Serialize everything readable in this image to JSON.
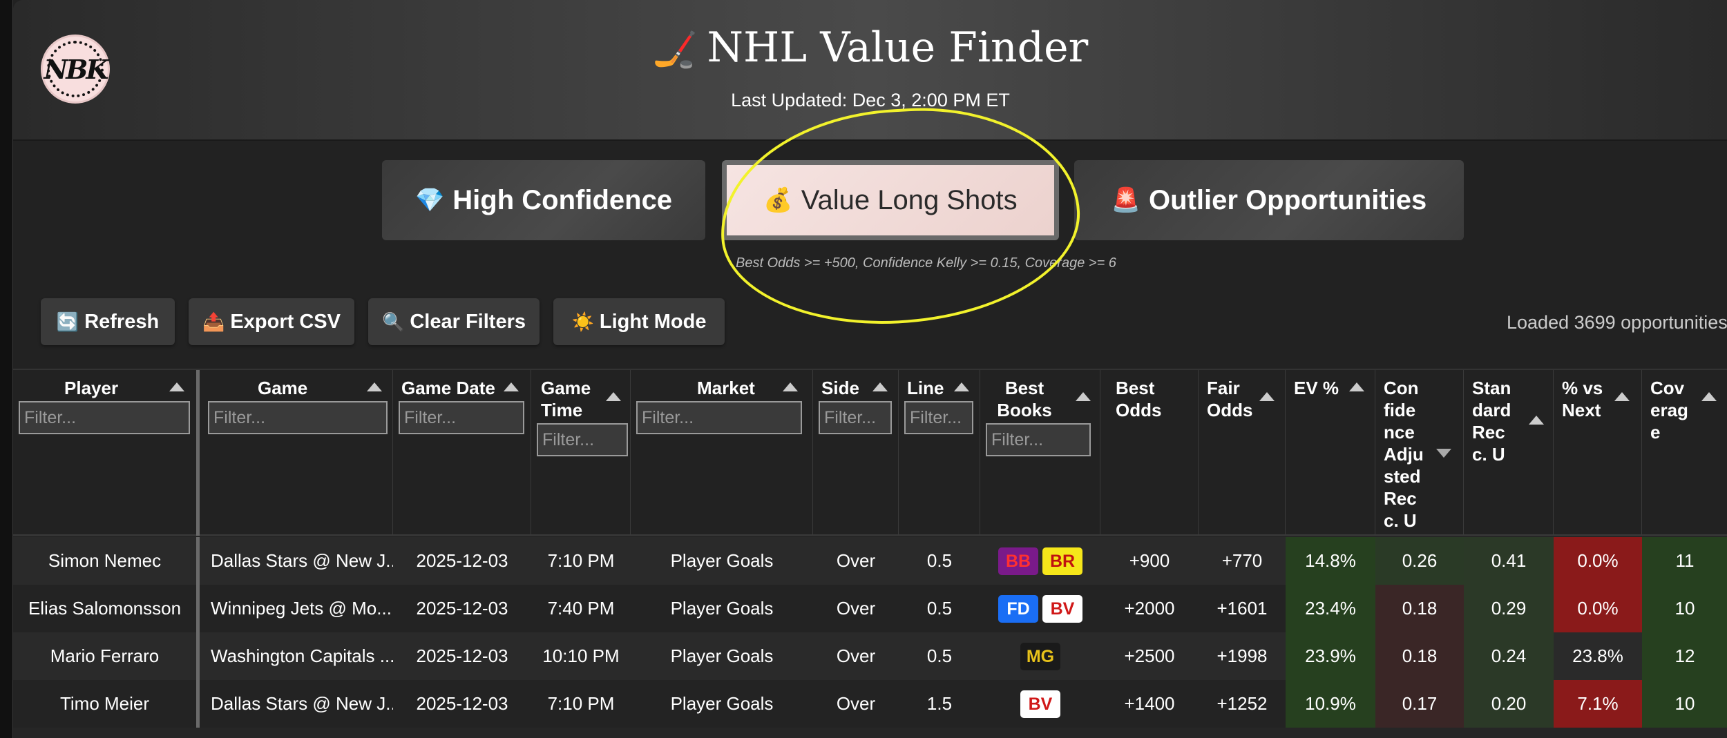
{
  "header": {
    "title": "NHL Value Finder",
    "title_icon": "hockey-stick-icon",
    "last_updated": "Last Updated: Dec 3, 2:00 PM ET",
    "logo_text": "NBK"
  },
  "tabs": [
    {
      "icon": "💎",
      "label": "High Confidence",
      "active": false
    },
    {
      "icon": "💰",
      "label": "Value Long Shots",
      "active": true
    },
    {
      "icon": "🚨",
      "label": "Outlier Opportunities",
      "active": false
    }
  ],
  "tab_hint": "Best Odds >= +500, Confidence Kelly >= 0.15, Coverage >= 6",
  "toolbar": {
    "refresh": {
      "icon": "🔄",
      "label": "Refresh"
    },
    "export": {
      "icon": "📤",
      "label": "Export CSV"
    },
    "clear": {
      "icon": "🔍",
      "label": "Clear Filters"
    },
    "light": {
      "icon": "☀️",
      "label": "Light Mode"
    }
  },
  "status": "Loaded 3699 opportunities",
  "filter_placeholder": "Filter...",
  "columns": [
    {
      "key": "player",
      "label": "Player"
    },
    {
      "key": "game",
      "label": "Game"
    },
    {
      "key": "date",
      "label": "Game Date"
    },
    {
      "key": "time",
      "label": "Game Time"
    },
    {
      "key": "market",
      "label": "Market"
    },
    {
      "key": "side",
      "label": "Side"
    },
    {
      "key": "line",
      "label": "Line"
    },
    {
      "key": "books",
      "label": "Best Books"
    },
    {
      "key": "best_odds",
      "label": "Best Odds"
    },
    {
      "key": "fair_odds",
      "label": "Fair Odds"
    },
    {
      "key": "ev",
      "label": "EV %"
    },
    {
      "key": "conf",
      "label": "Confidence Adjusted Recc. U"
    },
    {
      "key": "std",
      "label": "Standard Recc. U"
    },
    {
      "key": "vsnext",
      "label": "% vs Next"
    },
    {
      "key": "coverage",
      "label": "Coverage"
    }
  ],
  "rows": [
    {
      "player": "Simon Nemec",
      "game": "Dallas Stars @ New J...",
      "date": "2025-12-03",
      "time": "7:10 PM",
      "market": "Player Goals",
      "side": "Over",
      "line": "0.5",
      "books": [
        {
          "code": "BB",
          "bg": "#7a1a8a",
          "fg": "#ff3030"
        },
        {
          "code": "BR",
          "bg": "#f5e61a",
          "fg": "#c01010"
        }
      ],
      "best_odds": "+900",
      "fair_odds": "+770",
      "ev": "14.8%",
      "conf": "0.26",
      "std": "0.41",
      "vsnext": "0.0%",
      "coverage": "11"
    },
    {
      "player": "Elias Salomonsson",
      "game": "Winnipeg Jets @ Mo...",
      "date": "2025-12-03",
      "time": "7:40 PM",
      "market": "Player Goals",
      "side": "Over",
      "line": "0.5",
      "books": [
        {
          "code": "FD",
          "bg": "#1a6ef5",
          "fg": "#ffffff"
        },
        {
          "code": "BV",
          "bg": "#ffffff",
          "fg": "#d01818"
        }
      ],
      "best_odds": "+2000",
      "fair_odds": "+1601",
      "ev": "23.4%",
      "conf": "0.18",
      "std": "0.29",
      "vsnext": "0.0%",
      "coverage": "10"
    },
    {
      "player": "Mario Ferraro",
      "game": "Washington Capitals ...",
      "date": "2025-12-03",
      "time": "10:10 PM",
      "market": "Player Goals",
      "side": "Over",
      "line": "0.5",
      "books": [
        {
          "code": "MG",
          "bg": "#1a1a1a",
          "fg": "#e8c21a"
        }
      ],
      "best_odds": "+2500",
      "fair_odds": "+1998",
      "ev": "23.9%",
      "conf": "0.18",
      "std": "0.24",
      "vsnext": "23.8%",
      "coverage": "12"
    },
    {
      "player": "Timo Meier",
      "game": "Dallas Stars @ New J...",
      "date": "2025-12-03",
      "time": "7:10 PM",
      "market": "Player Goals",
      "side": "Over",
      "line": "1.5",
      "books": [
        {
          "code": "BV",
          "bg": "#ffffff",
          "fg": "#d01818"
        }
      ],
      "best_odds": "+1400",
      "fair_odds": "+1252",
      "ev": "10.9%",
      "conf": "0.17",
      "std": "0.20",
      "vsnext": "7.1%",
      "coverage": "10"
    }
  ],
  "cell_tones": {
    "ev": [
      "g",
      "g",
      "g",
      "g"
    ],
    "conf": [
      "gd",
      "dk",
      "dk",
      "dk"
    ],
    "std": [
      "gdim",
      "gdim",
      "gdim",
      "gdim"
    ],
    "vsnext": [
      "r",
      "r",
      "",
      "r"
    ],
    "coverage": [
      "g",
      "g",
      "g",
      "g"
    ]
  }
}
